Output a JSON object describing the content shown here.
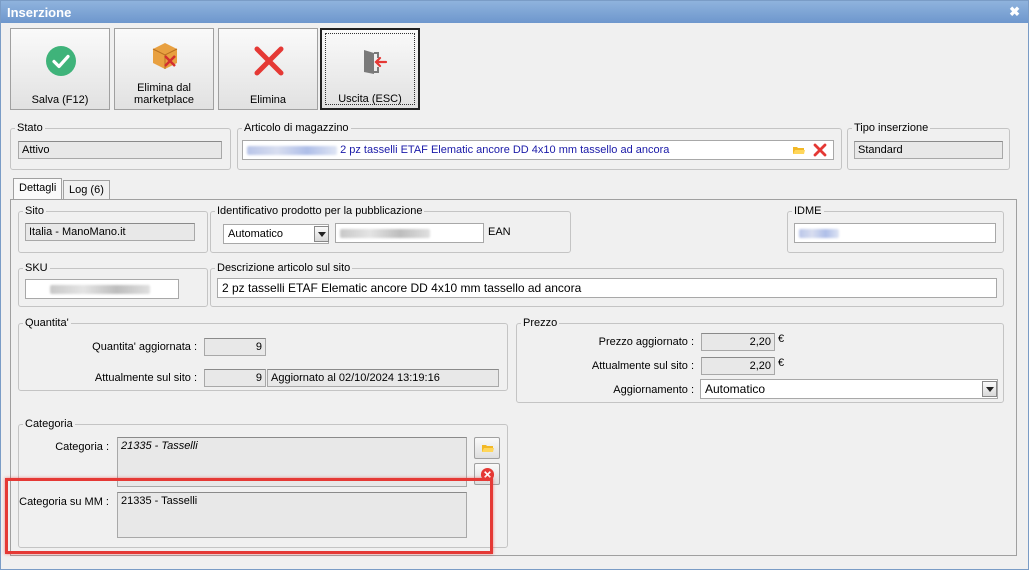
{
  "window": {
    "title": "Inserzione",
    "close_glyph": "✖"
  },
  "toolbar": {
    "save_label": "Salva (F12)",
    "remove_marketplace_line1": "Elimina dal",
    "remove_marketplace_line2": "marketplace",
    "delete_label": "Elimina",
    "exit_label": "Uscita (ESC)"
  },
  "header": {
    "stato_legend": "Stato",
    "stato_value": "Attivo",
    "articolo_legend": "Articolo di magazzino",
    "articolo_value": "2 pz tasselli ETAF Elematic ancore DD 4x10 mm tassello ad ancora",
    "tipo_legend": "Tipo inserzione",
    "tipo_value": "Standard"
  },
  "tabs": [
    {
      "label": "Dettagli"
    },
    {
      "label": "Log (6)"
    }
  ],
  "dettagli": {
    "sito_legend": "Sito",
    "sito_value": "Italia - ManoMano.it",
    "identificativo_legend": "Identificativo prodotto per la pubblicazione",
    "identificativo_select": "Automatico",
    "identificativo_type": "EAN",
    "idme_legend": "IDME",
    "sku_legend": "SKU",
    "descrizione_legend": "Descrizione articolo sul sito",
    "descrizione_value": "2 pz tasselli ETAF Elematic ancore DD 4x10 mm tassello ad ancora"
  },
  "quantita": {
    "legend": "Quantita'",
    "aggiornata_label": "Quantita' aggiornata :",
    "aggiornata_value": "9",
    "sul_sito_label": "Attualmente sul sito :",
    "sul_sito_value": "9",
    "aggiornato_al": "Aggiornato al 02/10/2024 13:19:16"
  },
  "prezzo": {
    "legend": "Prezzo",
    "aggiornato_label": "Prezzo aggiornato :",
    "aggiornato_value": "2,20",
    "sul_sito_label": "Attualmente sul sito :",
    "sul_sito_value": "2,20",
    "currency": "€",
    "aggiornamento_label": "Aggiornamento :",
    "aggiornamento_value": "Automatico"
  },
  "categoria": {
    "legend": "Categoria",
    "categoria_label": "Categoria :",
    "categoria_value": "21335 - Tasselli",
    "mm_label": "Categoria su MM :",
    "mm_value": "21335 - Tasselli"
  },
  "colors": {
    "highlight": "#e53935",
    "link_blue": "#1a1aa8",
    "title_bar": "#6e97cd"
  }
}
